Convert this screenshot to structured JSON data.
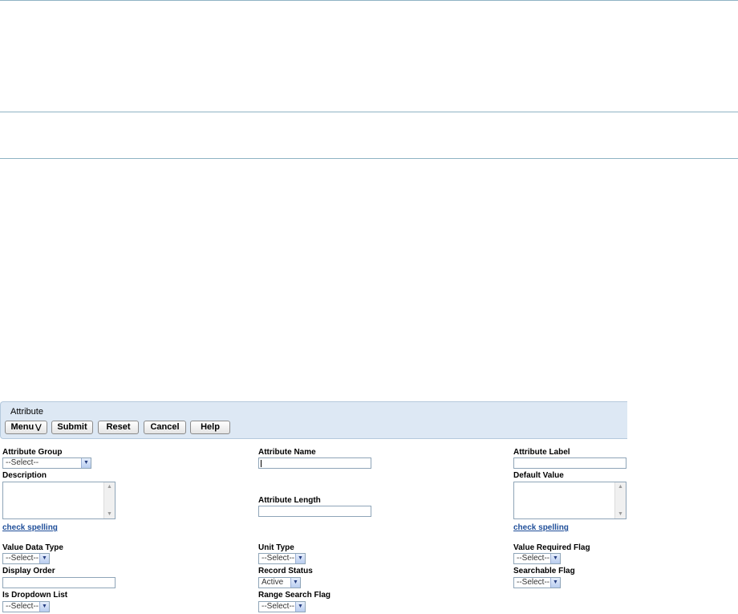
{
  "toolbar": {
    "title": "Attribute",
    "menu_label": "Menu",
    "submit_label": "Submit",
    "reset_label": "Reset",
    "cancel_label": "Cancel",
    "help_label": "Help",
    "menu_icon": "double-down-caret-icon"
  },
  "form": {
    "attribute_group": {
      "label": "Attribute Group",
      "value": "--Select--"
    },
    "description": {
      "label": "Description",
      "value": ""
    },
    "check_spelling_left": "check spelling",
    "value_data_type": {
      "label": "Value Data Type",
      "value": "--Select--"
    },
    "display_order": {
      "label": "Display Order",
      "value": ""
    },
    "is_dropdown_list": {
      "label": "Is Dropdown List",
      "value": "--Select--"
    },
    "attribute_name": {
      "label": "Attribute Name",
      "value": ""
    },
    "attribute_length": {
      "label": "Attribute Length",
      "value": ""
    },
    "unit_type": {
      "label": "Unit Type",
      "value": "--Select--"
    },
    "record_status": {
      "label": "Record Status",
      "value": "Active"
    },
    "range_search_flag": {
      "label": "Range Search Flag",
      "value": "--Select--"
    },
    "attribute_label": {
      "label": "Attribute Label",
      "value": ""
    },
    "default_value": {
      "label": "Default Value",
      "value": ""
    },
    "check_spelling_right": "check spelling",
    "value_required_flag": {
      "label": "Value Required Flag",
      "value": "--Select--"
    },
    "searchable_flag": {
      "label": "Searchable Flag",
      "value": "--Select--"
    }
  },
  "colors": {
    "panel_bg": "#dde8f4",
    "divider": "#8fb3c4",
    "link": "#1f4e99"
  }
}
